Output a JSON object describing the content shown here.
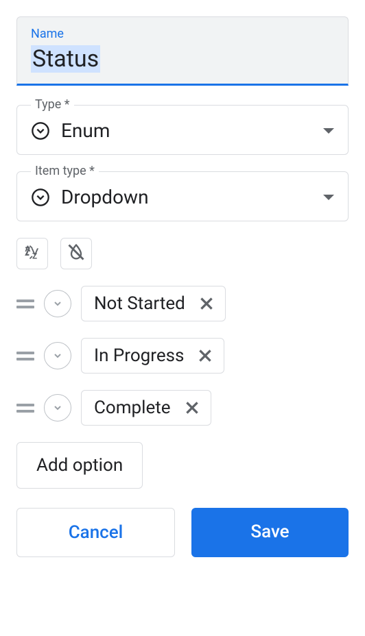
{
  "name_field": {
    "label": "Name",
    "value": "Status"
  },
  "type_field": {
    "label": "Type *",
    "value": "Enum"
  },
  "item_type_field": {
    "label": "Item type *",
    "value": "Dropdown"
  },
  "options": [
    {
      "label": "Not Started"
    },
    {
      "label": "In Progress"
    },
    {
      "label": "Complete"
    }
  ],
  "buttons": {
    "add_option": "Add option",
    "cancel": "Cancel",
    "save": "Save"
  }
}
